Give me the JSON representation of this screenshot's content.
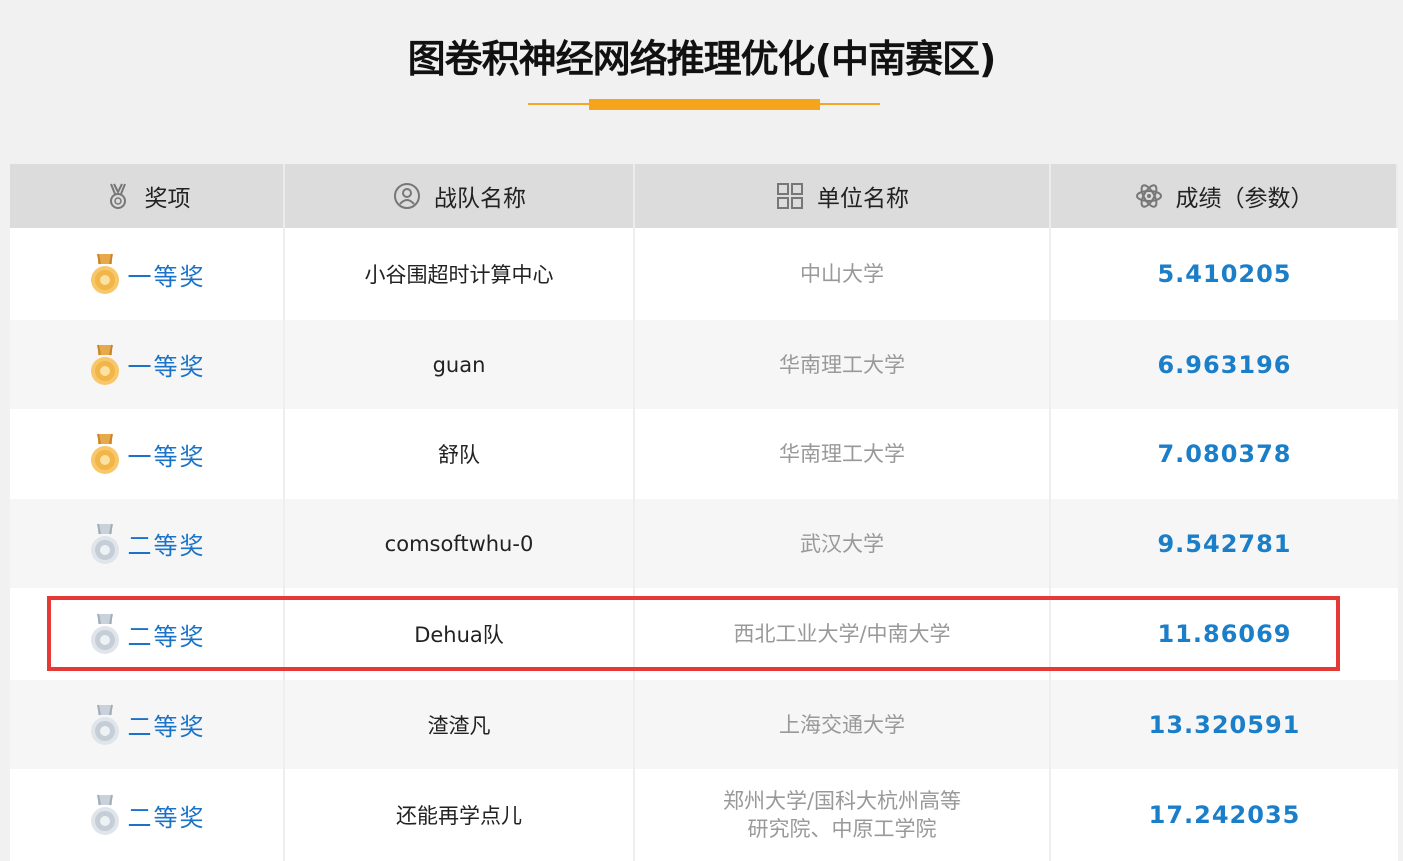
{
  "page": {
    "title": "图卷积神经网络推理优化(中南赛区)"
  },
  "table": {
    "headers": {
      "award": "奖项",
      "team": "战队名称",
      "unit": "单位名称",
      "score": "成绩（参数）"
    },
    "rows": [
      {
        "award": "一等奖",
        "medal": "gold",
        "team": "小谷围超时计算中心",
        "unit_line1": "中山大学",
        "unit_line2": "",
        "score": "5.410205"
      },
      {
        "award": "一等奖",
        "medal": "gold",
        "team": "guan",
        "unit_line1": "华南理工大学",
        "unit_line2": "",
        "score": "6.963196"
      },
      {
        "award": "一等奖",
        "medal": "gold",
        "team": "舒队",
        "unit_line1": "华南理工大学",
        "unit_line2": "",
        "score": "7.080378"
      },
      {
        "award": "二等奖",
        "medal": "silver",
        "team": "comsoftwhu-0",
        "unit_line1": "武汉大学",
        "unit_line2": "",
        "score": "9.542781"
      },
      {
        "award": "二等奖",
        "medal": "silver",
        "team": "Dehua队",
        "unit_line1": "西北工业大学/中南大学",
        "unit_line2": "",
        "score": "11.86069"
      },
      {
        "award": "二等奖",
        "medal": "silver",
        "team": "渣渣凡",
        "unit_line1": "上海交通大学",
        "unit_line2": "",
        "score": "13.320591"
      },
      {
        "award": "二等奖",
        "medal": "silver",
        "team": "还能再学点儿",
        "unit_line1": "郑州大学/国科大杭州高等",
        "unit_line2": "研究院、中原工学院",
        "score": "17.242035"
      }
    ]
  },
  "colors": {
    "accent": "#f5a623",
    "link_blue": "#1a73c8",
    "highlight_red": "#e53935"
  },
  "icons": {
    "award_header": "medal-icon",
    "team_header": "user-icon",
    "unit_header": "grid-icon",
    "score_header": "atom-icon",
    "gold": "gold-medal-icon",
    "silver": "silver-medal-icon"
  }
}
